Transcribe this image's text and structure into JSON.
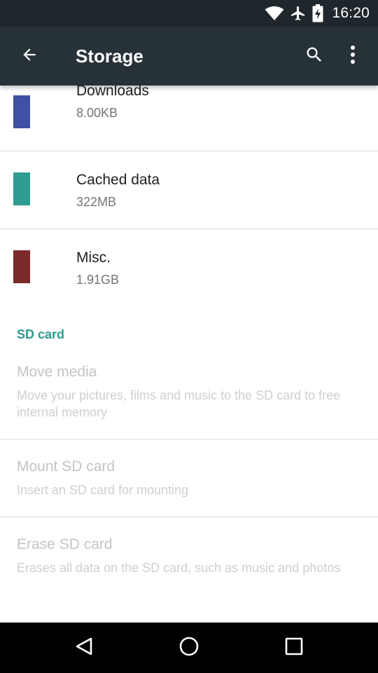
{
  "status_bar": {
    "time": "16:20",
    "icons": [
      "wifi-icon",
      "airplane-mode-icon",
      "battery-charging-icon"
    ]
  },
  "app_bar": {
    "title": "Storage",
    "icons": [
      "back-arrow-icon",
      "search-icon",
      "more-vert-icon"
    ]
  },
  "storage_items": [
    {
      "label": "Downloads",
      "size": "8.00KB",
      "color": "#3f51a3"
    },
    {
      "label": "Cached data",
      "size": "322MB",
      "color": "#2f9c92"
    },
    {
      "label": "Misc.",
      "size": "1.91GB",
      "color": "#7b2a2a"
    }
  ],
  "sd_card": {
    "header": "SD card",
    "items": [
      {
        "title": "Move media",
        "summary": "Move your pictures, films and music to the SD card to free internal memory"
      },
      {
        "title": "Mount SD card",
        "summary": "Insert an SD card for mounting"
      },
      {
        "title": "Erase SD card",
        "summary": "Erases all data on the SD card, such as music and photos"
      }
    ]
  },
  "nav_bar": {
    "icons": [
      "back-triangle-icon",
      "home-circle-icon",
      "recents-square-icon"
    ]
  }
}
